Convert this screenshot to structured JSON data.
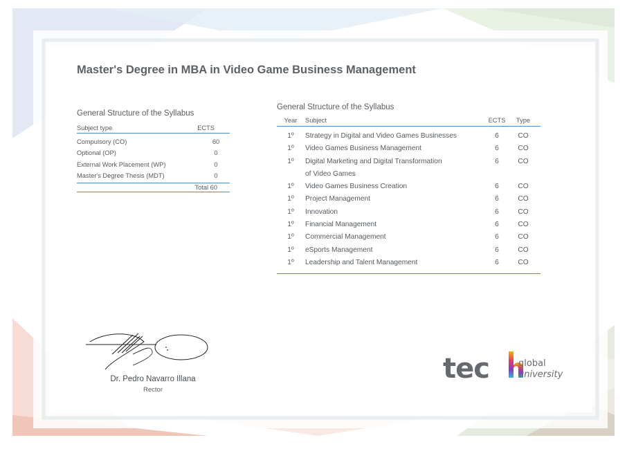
{
  "title": "Master's Degree in MBA in Video Game Business Management",
  "summary": {
    "heading": "General Structure of the Syllabus",
    "col_type": "Subject type",
    "col_ects": "ECTS",
    "rows": [
      {
        "type": "Compulsory (CO)",
        "ects": "60"
      },
      {
        "type": "Optional (OP)",
        "ects": "0"
      },
      {
        "type": "External Work Placement (WP)",
        "ects": "0"
      },
      {
        "type": "Master's Degree Thesis (MDT)",
        "ects": "0"
      }
    ],
    "total": "Total 60"
  },
  "detail": {
    "heading": "General Structure of the Syllabus",
    "col_year": "Year",
    "col_subject": "Subject",
    "col_ects": "ECTS",
    "col_type": "Type",
    "rows": [
      {
        "year": "1º",
        "subject": "Strategy in Digital and Video Games Businesses",
        "ects": "6",
        "type": "CO"
      },
      {
        "year": "1º",
        "subject": "Video Games Business Management",
        "ects": "6",
        "type": "CO"
      },
      {
        "year": "1º",
        "subject": "Digital Marketing and Digital Transformation",
        "subject2": "of Video Games",
        "ects": "6",
        "type": "CO"
      },
      {
        "year": "1º",
        "subject": "Video Games Business Creation",
        "ects": "6",
        "type": "CO"
      },
      {
        "year": "1º",
        "subject": "Project Management",
        "ects": "6",
        "type": "CO"
      },
      {
        "year": "1º",
        "subject": "Innovation",
        "ects": "6",
        "type": "CO"
      },
      {
        "year": "1º",
        "subject": "Financial Management",
        "ects": "6",
        "type": "CO"
      },
      {
        "year": "1º",
        "subject": "Commercial Management",
        "ects": "6",
        "type": "CO"
      },
      {
        "year": "1º",
        "subject": "eSports Management",
        "ects": "6",
        "type": "CO"
      },
      {
        "year": "1º",
        "subject": "Leadership and Talent Management",
        "ects": "6",
        "type": "CO"
      }
    ]
  },
  "signer": {
    "name": "Dr. Pedro Navarro Illana",
    "role": "Rector"
  },
  "logo": {
    "brand": "tech",
    "line1": "global",
    "line2": "university"
  },
  "colors": {
    "rule_blue": "#4a90c8",
    "logo_gray": "#666a6e"
  }
}
